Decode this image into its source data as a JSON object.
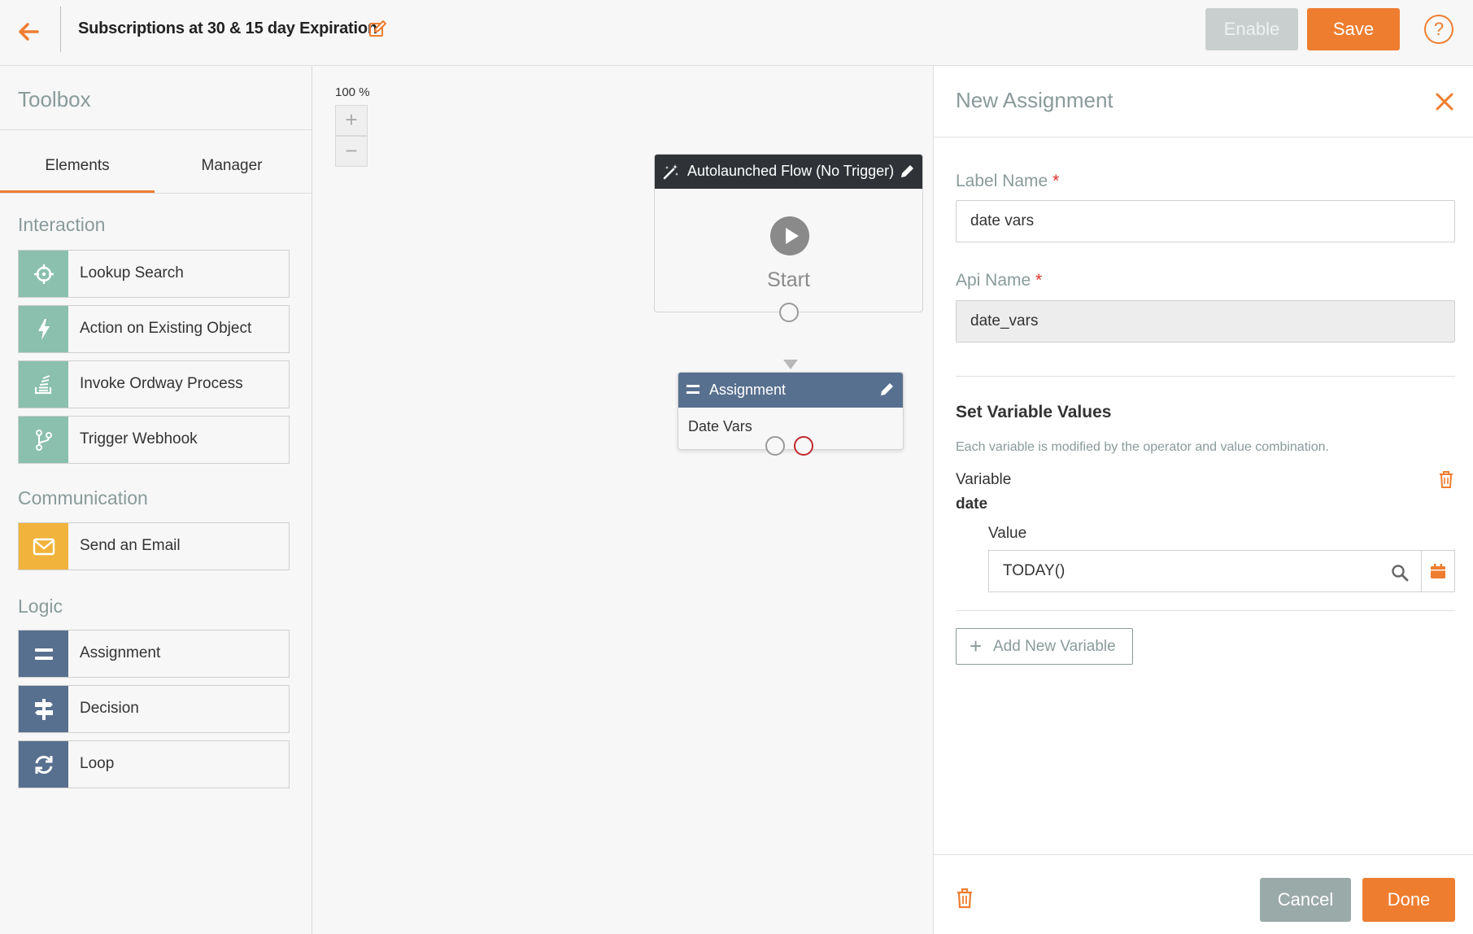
{
  "header": {
    "title": "Subscriptions at 30 & 15 day Expiration",
    "enable_label": "Enable",
    "save_label": "Save",
    "help_label": "?"
  },
  "toolbox": {
    "title": "Toolbox",
    "tabs": [
      {
        "label": "Elements",
        "active": true
      },
      {
        "label": "Manager",
        "active": false
      }
    ],
    "sections": [
      {
        "label": "Interaction",
        "items": [
          {
            "label": "Lookup Search",
            "icon": "crosshair-icon"
          },
          {
            "label": "Action on Existing Object",
            "icon": "lightning-icon"
          },
          {
            "label": "Invoke Ordway Process",
            "icon": "stack-icon"
          },
          {
            "label": "Trigger Webhook",
            "icon": "branch-icon"
          }
        ]
      },
      {
        "label": "Communication",
        "items": [
          {
            "label": "Send an Email",
            "icon": "envelope-icon"
          }
        ]
      },
      {
        "label": "Logic",
        "items": [
          {
            "label": "Assignment",
            "icon": "equals-icon"
          },
          {
            "label": "Decision",
            "icon": "signpost-icon"
          },
          {
            "label": "Loop",
            "icon": "loop-icon"
          }
        ]
      }
    ]
  },
  "canvas": {
    "zoom_label": "100 %",
    "zoom_in": "+",
    "zoom_out": "−",
    "start_node": {
      "header": "Autolaunched Flow (No Trigger)",
      "label": "Start"
    },
    "assignment_node": {
      "header": "Assignment",
      "body": "Date Vars"
    }
  },
  "panel": {
    "title": "New Assignment",
    "label_name": {
      "label": "Label Name",
      "required": "*",
      "value": "date vars"
    },
    "api_name": {
      "label": "Api Name",
      "required": "*",
      "value": "date_vars"
    },
    "set_values": {
      "heading": "Set Variable Values",
      "description": "Each variable is modified by the operator and value combination.",
      "variable_label": "Variable",
      "variable_name": "date",
      "value_label": "Value",
      "value": "TODAY()"
    },
    "add_variable_label": "Add New Variable",
    "cancel_label": "Cancel",
    "done_label": "Done"
  },
  "colors": {
    "accent": "#ee7d30",
    "interaction": "#8ac0ad",
    "communication": "#f1b33b",
    "logic": "#58708f",
    "node_dark": "#2f3337",
    "error": "#c0282a"
  }
}
